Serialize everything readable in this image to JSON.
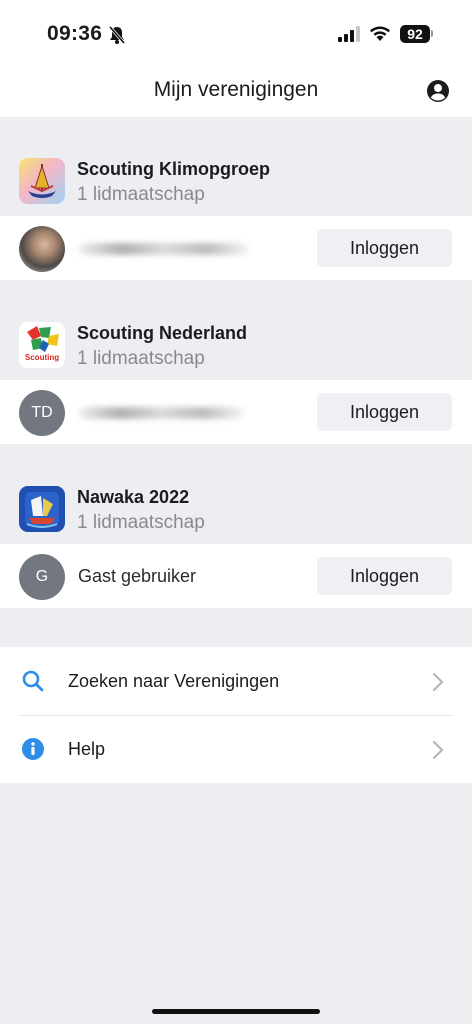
{
  "status_bar": {
    "time": "09:36",
    "battery": "92"
  },
  "nav": {
    "title": "Mijn verenigingen"
  },
  "organizations": [
    {
      "name": "Scouting Klimopgroep",
      "subtitle": "1 lidmaatschap",
      "member": {
        "initials": "",
        "name": "",
        "name_blurred": true,
        "login_label": "Inloggen"
      }
    },
    {
      "name": "Scouting Nederland",
      "subtitle": "1 lidmaatschap",
      "logo_text": "Scouting",
      "member": {
        "initials": "TD",
        "name": "",
        "name_blurred": true,
        "login_label": "Inloggen"
      }
    },
    {
      "name": "Nawaka 2022",
      "subtitle": "1 lidmaatschap",
      "member": {
        "initials": "G",
        "name": "Gast gebruiker",
        "name_blurred": false,
        "login_label": "Inloggen"
      }
    }
  ],
  "menu": {
    "items": [
      {
        "label": "Zoeken naar Verenigingen",
        "icon": "search-icon"
      },
      {
        "label": "Help",
        "icon": "info-icon"
      }
    ]
  },
  "colors": {
    "background": "#eceef2",
    "accent": "#2e8de6",
    "avatar": "#737880"
  }
}
